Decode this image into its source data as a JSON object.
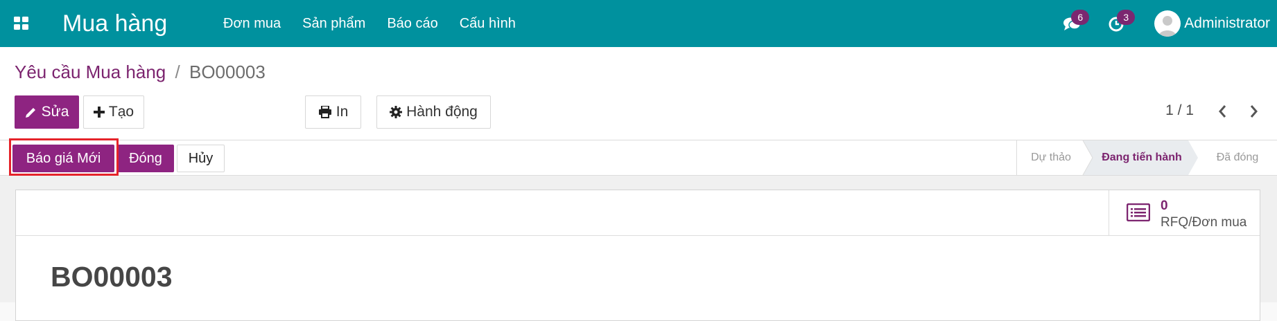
{
  "navbar": {
    "app_icon": "apps-grid-icon",
    "brand": "Mua hàng",
    "menu": [
      "Đơn mua",
      "Sản phẩm",
      "Báo cáo",
      "Cấu hình"
    ],
    "messages": {
      "icon": "chat-icon",
      "count": "6"
    },
    "activities": {
      "icon": "clock-icon",
      "count": "3"
    },
    "user": {
      "avatar_icon": "user-avatar-icon",
      "name": "Administrator"
    },
    "color": "#00919e"
  },
  "breadcrumb": {
    "parent": "Yêu cầu Mua hàng",
    "separator": "/",
    "current": "BO00003"
  },
  "toolbar": {
    "edit_label": "Sửa",
    "create_label": "Tạo",
    "print_label": "In",
    "action_label": "Hành động",
    "icons": {
      "edit": "pencil-icon",
      "create": "plus-icon",
      "print": "print-icon",
      "action": "gear-icon"
    }
  },
  "pager": {
    "value": "1 / 1",
    "prev_icon": "chevron-left-icon",
    "next_icon": "chevron-right-icon"
  },
  "statusbar": {
    "buttons": [
      "Báo giá Mới",
      "Đóng",
      "Hủy"
    ],
    "stages": [
      "Dự thảo",
      "Đang tiến hành",
      "Đã đóng"
    ],
    "active_stage": "Đang tiến hành"
  },
  "smart_button": {
    "icon": "list-icon",
    "value": "0",
    "label": "RFQ/Đơn mua"
  },
  "record": {
    "title": "BO00003"
  },
  "colors": {
    "primary": "#8e2481",
    "link": "#7c246f",
    "highlight": "#e5232a"
  }
}
